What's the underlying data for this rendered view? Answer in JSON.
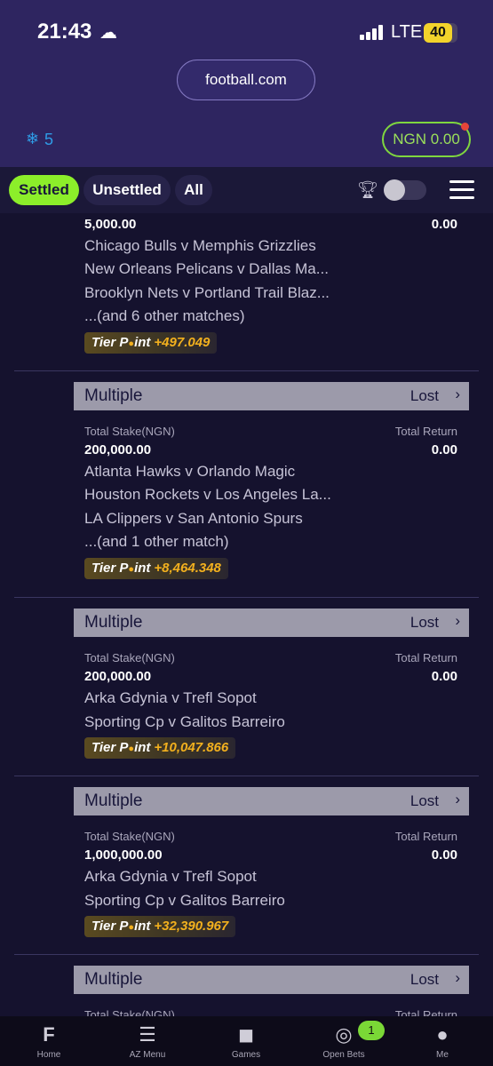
{
  "status_bar": {
    "time": "21:43",
    "time_icon": "☁",
    "network": "LTE",
    "battery": "40"
  },
  "browser": {
    "url": "football.com"
  },
  "header": {
    "snow_icon": "❄",
    "snow_count": "5",
    "balance": "NGN 0.00"
  },
  "filters": {
    "tabs": [
      "Settled",
      "Unsettled",
      "All"
    ],
    "active": "Settled"
  },
  "bets": [
    {
      "stake": "5,000.00",
      "return": "0.00",
      "matches": [
        "Chicago Bulls v Memphis Grizzlies",
        "New Orleans Pelicans v Dallas Ma...",
        "Brooklyn Nets v Portland Trail Blaz...",
        "...(and 6 other matches)"
      ],
      "tier_label": "Tier P",
      "tier_label_end": "int",
      "tier_points": "+497.049"
    },
    {
      "type": "Multiple",
      "status": "Lost",
      "stake_label": "Total Stake(NGN)",
      "return_label": "Total Return",
      "stake": "200,000.00",
      "return": "0.00",
      "matches": [
        "Atlanta Hawks v Orlando Magic",
        "Houston Rockets v Los Angeles La...",
        "LA Clippers v San Antonio Spurs",
        "...(and 1 other match)"
      ],
      "tier_label": "Tier P",
      "tier_label_end": "int",
      "tier_points": "+8,464.348"
    },
    {
      "type": "Multiple",
      "status": "Lost",
      "stake_label": "Total Stake(NGN)",
      "return_label": "Total Return",
      "stake": "200,000.00",
      "return": "0.00",
      "matches": [
        "Arka Gdynia v Trefl Sopot",
        "Sporting Cp v Galitos Barreiro"
      ],
      "tier_label": "Tier P",
      "tier_label_end": "int",
      "tier_points": "+10,047.866"
    },
    {
      "type": "Multiple",
      "status": "Lost",
      "stake_label": "Total Stake(NGN)",
      "return_label": "Total Return",
      "stake": "1,000,000.00",
      "return": "0.00",
      "matches": [
        "Arka Gdynia v Trefl Sopot",
        "Sporting Cp v Galitos Barreiro"
      ],
      "tier_label": "Tier P",
      "tier_label_end": "int",
      "tier_points": "+32,390.967"
    },
    {
      "type": "Multiple",
      "status": "Lost",
      "stake_label": "Total Stake(NGN)",
      "return_label": "Total Return"
    }
  ],
  "bottom_nav": [
    {
      "label": "Home",
      "icon": "football-logo-icon"
    },
    {
      "label": "AZ Menu",
      "icon": "menu-icon"
    },
    {
      "label": "Games",
      "icon": "gamepad-icon"
    },
    {
      "label": "Open Bets",
      "icon": "bet-slip-icon",
      "badge": "1"
    },
    {
      "label": "Me",
      "icon": "user-icon"
    }
  ],
  "colors": {
    "accent": "#8cee2a",
    "header_bg": "#2e2560",
    "page_bg": "#15122e",
    "tier_gold": "#f2b01e"
  }
}
